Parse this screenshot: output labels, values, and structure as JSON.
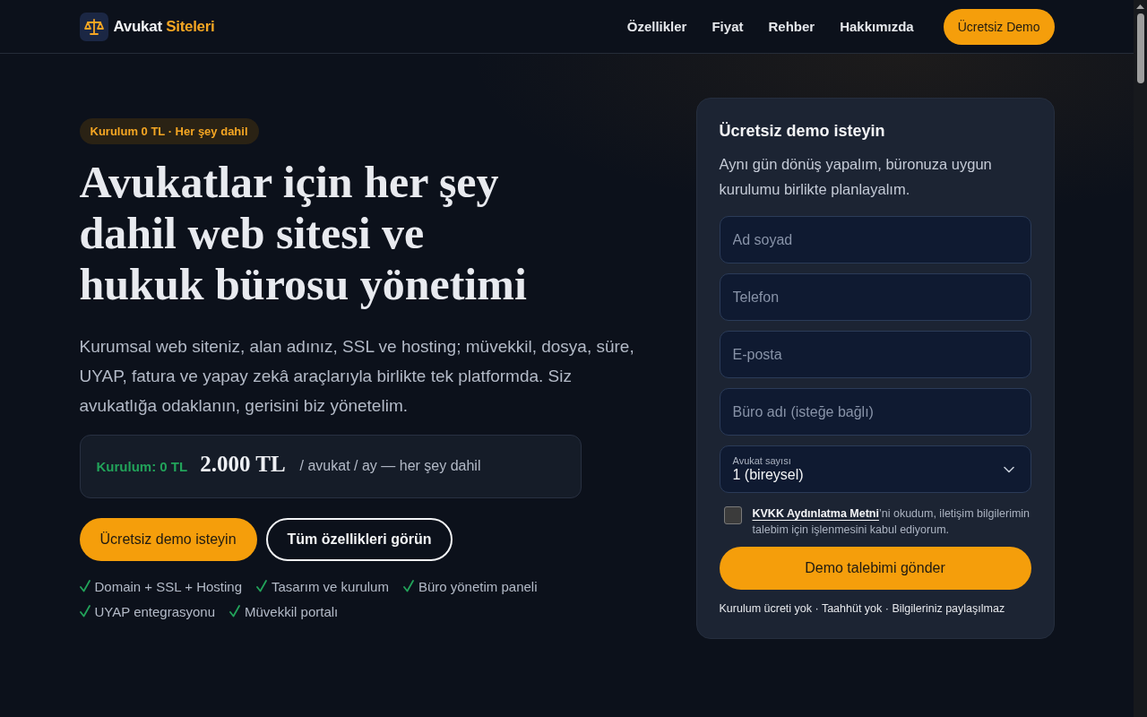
{
  "header": {
    "brand": {
      "name": "Avukat",
      "accent": "Siteleri"
    },
    "nav": [
      {
        "label": "Özellikler"
      },
      {
        "label": "Fiyat"
      },
      {
        "label": "Rehber"
      },
      {
        "label": "Hakkımızda"
      }
    ],
    "cta": "Ücretsiz Demo"
  },
  "hero": {
    "badge": "Kurulum 0 TL · Her şey dahil",
    "title": "Avukatlar için her şey dahil web sitesi ve hukuk bürosu yönetimi",
    "lead": "Kurumsal web siteniz, alan adınız, SSL ve hosting; müvekkil, dosya, süre, UYAP, fatura ve yapay zekâ araçlarıyla birlikte tek platformda. Siz avukatlığa odaklanın, gerisini biz yönetelim.",
    "price": {
      "setup": "Kurulum: 0 TL",
      "amount": "2.000 TL",
      "period": "/ avukat / ay — her şey dahil"
    },
    "buttons": [
      {
        "kind": "primary",
        "label": "Ücretsiz demo isteyin"
      },
      {
        "kind": "secondary",
        "label": "Tüm özellikleri görün"
      }
    ],
    "features": [
      "Domain + SSL + Hosting",
      "Tasarım ve kurulum",
      "Büro yönetim paneli",
      "UYAP entegrasyonu",
      "Müvekkil portalı"
    ]
  },
  "demo_form": {
    "title": "Ücretsiz demo isteyin",
    "subtitle": "Aynı gün dönüş yapalım, büronuza uygun kurulumu birlikte planlayalım.",
    "fields": [
      {
        "kind": "input",
        "placeholder": "Ad soyad"
      },
      {
        "kind": "input",
        "placeholder": "Telefon"
      },
      {
        "kind": "input",
        "placeholder": "E-posta"
      },
      {
        "kind": "input",
        "placeholder": "Büro adı (isteğe bağlı)"
      },
      {
        "kind": "select",
        "label": "Avukat sayısı",
        "value": "1 (bireysel)"
      }
    ],
    "consent": {
      "checked": false,
      "link": "KVKK Aydınlatma Metni",
      "text": "’ni okudum, iletişim bilgilerimin talebim için işlenmesini kabul ediyorum."
    },
    "submit": "Demo talebimi gönder",
    "note": "Kurulum ücreti yok · Taahhüt yok · Bilgileriniz paylaşılmaz"
  }
}
